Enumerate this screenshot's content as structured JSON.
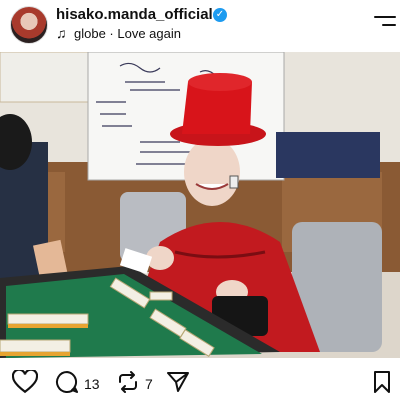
{
  "header": {
    "username": "hisako.manda_official",
    "music": "globe · Love again",
    "icons": {
      "avatar": "profile-avatar",
      "verified": "verified-badge-icon",
      "music": "music-note-icon",
      "menu": "menu-icon"
    }
  },
  "post": {
    "image_alt_subject": "woman in red hat and red kimono playing mahjong",
    "mute_icon": "mute-icon"
  },
  "actions": {
    "comment_count": "13",
    "repost_count": "7",
    "icons": [
      "heart-icon",
      "comment-icon",
      "repost-icon",
      "share-icon",
      "bookmark-icon"
    ]
  },
  "colors": {
    "verified": "#1d9bf0",
    "hat": "#d8141a",
    "table_felt": "#1f7a4c"
  }
}
